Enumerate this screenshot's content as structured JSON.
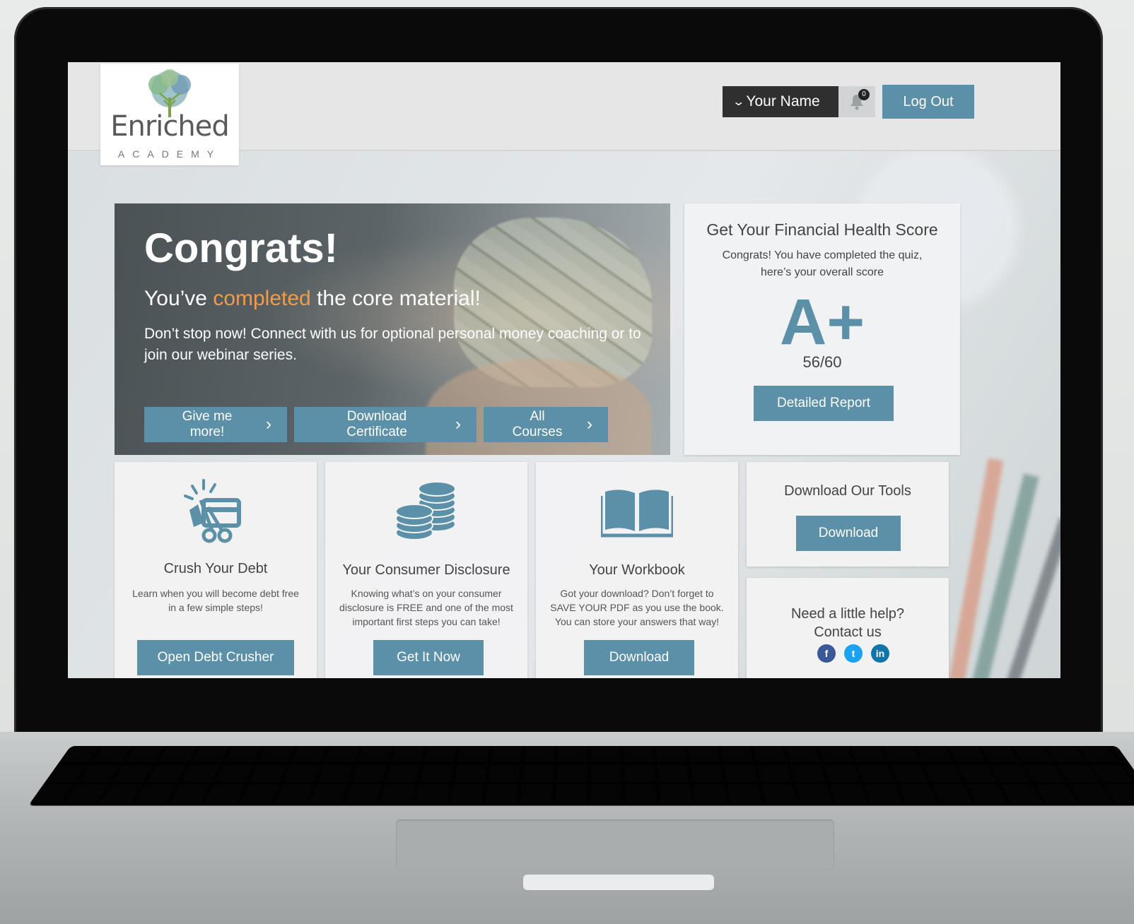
{
  "brand": {
    "name": "Enriched",
    "subtitle": "ACADEMY"
  },
  "header": {
    "user_name": "Your Name",
    "notification_count": "0",
    "logout_label": "Log Out"
  },
  "hero": {
    "title": "Congrats!",
    "subtitle_before": "You’ve ",
    "subtitle_accent": "completed",
    "subtitle_after": " the core material!",
    "text": "Don’t stop now! Connect with us for optional personal money coaching or to join our webinar series.",
    "buttons": [
      "Give me more!",
      "Download Certificate",
      "All Courses"
    ]
  },
  "score": {
    "title": "Get Your Financial Health Score",
    "description": "Congrats! You have completed the quiz, here’s your overall score",
    "grade": "A+",
    "value": "56/60",
    "button": "Detailed Report"
  },
  "cards": {
    "debt": {
      "title": "Crush Your Debt",
      "description": "Learn when you will become debt free in a few simple steps!",
      "button": "Open Debt Crusher",
      "icon": "scissors-credit-card-icon"
    },
    "disclosure": {
      "title": "Your Consumer Disclosure",
      "description": "Knowing what’s on your consumer disclosure is FREE and one of the most important first steps you can take!",
      "button": "Get It Now",
      "icon": "coins-icon"
    },
    "workbook": {
      "title": "Your Workbook",
      "description": "Got your download? Don’t forget to SAVE YOUR PDF as you use the book. You can store your answers that way!",
      "button": "Download",
      "icon": "book-icon"
    },
    "tools": {
      "title": "Download Our Tools",
      "button": "Download"
    },
    "help": {
      "title_line1": "Need a little help?",
      "title_line2": "Contact us",
      "social": [
        "f",
        "t",
        "in"
      ]
    }
  },
  "colors": {
    "accent": "#5b90a8",
    "highlight": "#f49b43",
    "facebook": "#3b5998",
    "twitter": "#1da1f2",
    "linkedin": "#0e76a8"
  }
}
